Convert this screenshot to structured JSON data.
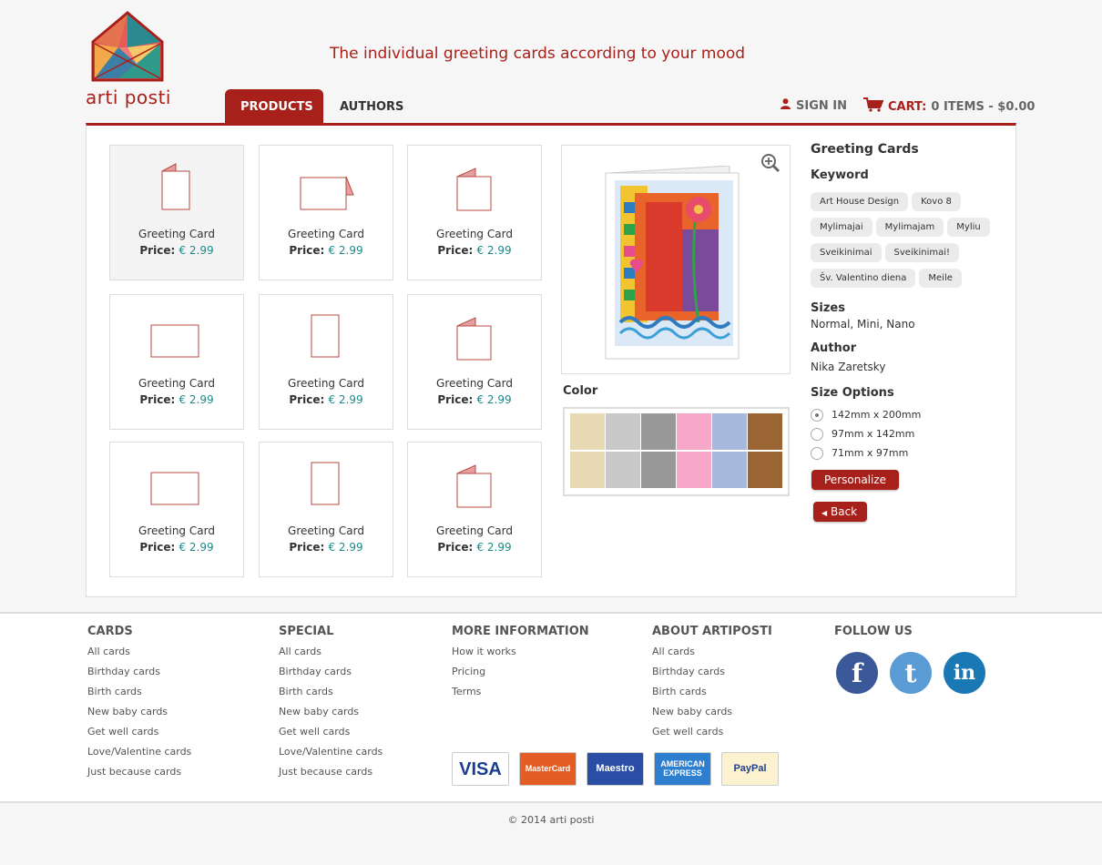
{
  "header": {
    "logo_text": "arti posti",
    "tagline": "The individual greeting cards according to your mood",
    "tabs": [
      {
        "label": "PRODUCTS"
      },
      {
        "label": "AUTHORS"
      }
    ],
    "sign_in": "SIGN IN",
    "cart_label": "CART:",
    "cart_summary": "0 ITEMS - $0.00"
  },
  "products": [
    {
      "name": "Greeting Card",
      "price_label": "Price:",
      "price": "€ 2.99",
      "shape": "portrait-fold"
    },
    {
      "name": "Greeting Card",
      "price_label": "Price:",
      "price": "€ 2.99",
      "shape": "landscape-fold"
    },
    {
      "name": "Greeting Card",
      "price_label": "Price:",
      "price": "€ 2.99",
      "shape": "square-fold"
    },
    {
      "name": "Greeting Card",
      "price_label": "Price:",
      "price": "€ 2.99",
      "shape": "landscape"
    },
    {
      "name": "Greeting Card",
      "price_label": "Price:",
      "price": "€ 2.99",
      "shape": "portrait"
    },
    {
      "name": "Greeting Card",
      "price_label": "Price:",
      "price": "€ 2.99",
      "shape": "square-fold"
    },
    {
      "name": "Greeting Card",
      "price_label": "Price:",
      "price": "€ 2.99",
      "shape": "landscape"
    },
    {
      "name": "Greeting Card",
      "price_label": "Price:",
      "price": "€ 2.99",
      "shape": "portrait"
    },
    {
      "name": "Greeting Card",
      "price_label": "Price:",
      "price": "€ 2.99",
      "shape": "square-fold"
    }
  ],
  "color": {
    "label": "Color",
    "swatches": [
      "#e8d9b5",
      "#c8c8c8",
      "#999999",
      "#f7a8c8",
      "#a6b8dc",
      "#9a6433"
    ]
  },
  "details": {
    "title": "Greeting Cards",
    "keyword_heading": "Keyword",
    "keywords": [
      "Art House Design",
      "Kovo 8",
      "Mylimajai",
      "Mylimajam",
      "Myliu",
      "Sveikinimai",
      "Sveikinimai!",
      "Šv. Valentino diena",
      "Meile"
    ],
    "sizes_heading": "Sizes",
    "sizes_value": "Normal, Mini, Nano",
    "author_heading": "Author",
    "author_value": "Nika Zaretsky",
    "size_options_heading": "Size Options",
    "size_options": [
      "142mm x 200mm",
      "97mm x 142mm",
      "71mm x 97mm"
    ],
    "selected_size": "142mm x 200mm",
    "personalize_label": "Personalize",
    "back_label": "Back"
  },
  "footer": {
    "columns": [
      {
        "heading": "CARDS",
        "links": [
          "All cards",
          "Birthday cards",
          "Birth cards",
          "New baby cards",
          "Get well cards",
          "Love/Valentine cards",
          "Just because cards"
        ]
      },
      {
        "heading": "SPECIAL",
        "links": [
          "All cards",
          "Birthday cards",
          "Birth cards",
          "New baby cards",
          "Get well cards",
          "Love/Valentine cards",
          "Just because cards"
        ]
      },
      {
        "heading": "MORE INFORMATION",
        "links": [
          "How it works",
          "Pricing",
          "Terms"
        ]
      },
      {
        "heading": "ABOUT ARTIPOSTI",
        "links": [
          "All cards",
          "Birthday cards",
          "Birth cards",
          "New baby cards",
          "Get well cards"
        ]
      }
    ],
    "follow_heading": "FOLLOW US",
    "social": [
      {
        "name": "facebook-icon",
        "glyph": "f",
        "color": "#3b5998"
      },
      {
        "name": "twitter-icon",
        "glyph": "t",
        "color": "#5b9bd5"
      },
      {
        "name": "linkedin-icon",
        "glyph": "in",
        "color": "#1a78b4"
      }
    ],
    "payments": [
      {
        "name": "visa-card",
        "label": "VISA",
        "bg": "#ffffff",
        "fg": "#1a3d8f"
      },
      {
        "name": "mastercard-card",
        "label": "MasterCard",
        "bg": "#e35d25",
        "fg": "#ffffff"
      },
      {
        "name": "maestro-card",
        "label": "Maestro",
        "bg": "#2a4ea6",
        "fg": "#ffffff"
      },
      {
        "name": "amex-card",
        "label": "AMERICAN EXPRESS",
        "bg": "#2e7fcf",
        "fg": "#ffffff"
      },
      {
        "name": "paypal-card",
        "label": "PayPal",
        "bg": "#fdf2d0",
        "fg": "#1d3f8f"
      }
    ],
    "copyright": "© 2014 arti posti"
  },
  "colors": {
    "brand_red": "#a8201a",
    "price_teal": "#1c8a8a"
  }
}
